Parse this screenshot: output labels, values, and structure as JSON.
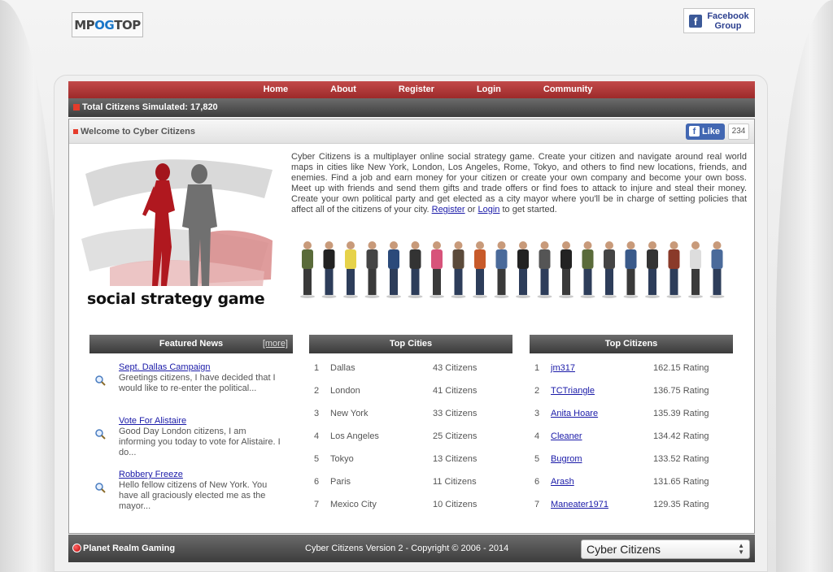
{
  "header": {
    "logo_text_a": "MP",
    "logo_text_b": "OG",
    "logo_text_c": "TOP",
    "facebook_group_line1": "Facebook",
    "facebook_group_line2": "Group"
  },
  "nav": {
    "items": [
      "Home",
      "About",
      "Register",
      "Login",
      "Community"
    ]
  },
  "status": {
    "text": "Total Citizens Simulated: 17,820"
  },
  "welcome": {
    "title": "Welcome to Cyber Citizens",
    "like_label": "Like",
    "like_count": "234"
  },
  "hero": {
    "caption": "social strategy game"
  },
  "intro": {
    "text_before": "Cyber Citizens is a multiplayer online social strategy game. Create your citizen and navigate around real world maps in cities like New York, London, Los Angeles, Rome, Tokyo, and others to find new locations, friends, and enemies. Find a job and earn money for your citizen or create your own company and become your own boss. Meet up with friends and send them gifts and trade offers or find foes to attack to injure and steal their money. Create your own political party and get elected as a city mayor where you'll be in charge of setting policies that affect all of the citizens of your city. ",
    "register_link": "Register",
    "or_text": " or ",
    "login_link": "Login",
    "text_after": " to get started."
  },
  "featured_news": {
    "title": "Featured News",
    "more": "[more]",
    "items": [
      {
        "title": "Sept. Dallas Campaign",
        "snippet": "Greetings citizens, I have decided that I would like to re-enter the political..."
      },
      {
        "title": "Vote For Alistaire",
        "snippet": "Good Day London citizens, I am informing you today to vote for Alistaire. I do..."
      },
      {
        "title": "Robbery Freeze",
        "snippet": "Hello fellow citizens of New York. You have all graciously elected me as the mayor..."
      }
    ]
  },
  "top_cities": {
    "title": "Top Cities",
    "rows": [
      {
        "rank": "1",
        "name": "Dallas",
        "value": "43 Citizens"
      },
      {
        "rank": "2",
        "name": "London",
        "value": "41 Citizens"
      },
      {
        "rank": "3",
        "name": "New York",
        "value": "33 Citizens"
      },
      {
        "rank": "4",
        "name": "Los Angeles",
        "value": "25 Citizens"
      },
      {
        "rank": "5",
        "name": "Tokyo",
        "value": "13 Citizens"
      },
      {
        "rank": "6",
        "name": "Paris",
        "value": "11 Citizens"
      },
      {
        "rank": "7",
        "name": "Mexico City",
        "value": "10 Citizens"
      }
    ]
  },
  "top_citizens": {
    "title": "Top Citizens",
    "rows": [
      {
        "rank": "1",
        "name": "jm317",
        "value": "162.15 Rating"
      },
      {
        "rank": "2",
        "name": "TCTriangle",
        "value": "136.75 Rating"
      },
      {
        "rank": "3",
        "name": "Anita Hoare",
        "value": "135.39 Rating"
      },
      {
        "rank": "4",
        "name": "Cleaner",
        "value": "134.42 Rating"
      },
      {
        "rank": "5",
        "name": "Bugrom",
        "value": "133.52 Rating"
      },
      {
        "rank": "6",
        "name": "Arash",
        "value": "131.65 Rating"
      },
      {
        "rank": "7",
        "name": "Maneater1971",
        "value": "129.35 Rating"
      }
    ]
  },
  "footer": {
    "brand": "Planet Realm Gaming",
    "copyright": "Cyber Citizens Version 2 - Copyright © 2006 - 2014",
    "game_select": "Cyber Citizens"
  },
  "colors": {
    "nav_red": "#b23a3a",
    "accent_red": "#e53b2b",
    "link_blue": "#1a1aa8",
    "facebook_blue": "#3b5998"
  }
}
